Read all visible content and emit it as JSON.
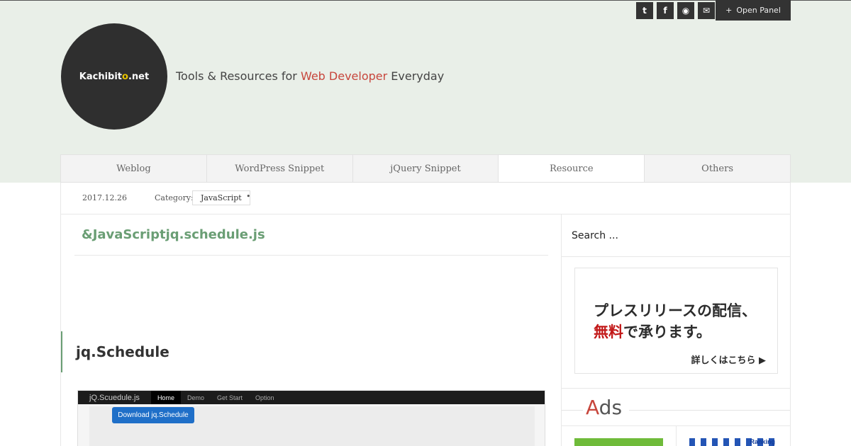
{
  "header": {
    "social": [
      {
        "icon": "twitter-icon",
        "glyph": "t"
      },
      {
        "icon": "facebook-icon",
        "glyph": "f"
      },
      {
        "icon": "rss-icon",
        "glyph": "◉"
      },
      {
        "icon": "mail-icon",
        "glyph": "✉"
      }
    ],
    "open_panel": {
      "plus": "+",
      "label": "Open Panel"
    },
    "logo": {
      "part1": "Kachibit",
      "highlight": "o",
      "part2": ".net"
    },
    "tagline": {
      "before": "Tools & Resources for ",
      "accent": "Web Developer",
      "after": " Everyday"
    }
  },
  "nav": {
    "tabs": [
      {
        "label": "Weblog"
      },
      {
        "label": "WordPress Snippet"
      },
      {
        "label": "jQuery Snippet"
      },
      {
        "label": "Resource"
      },
      {
        "label": "Others"
      }
    ]
  },
  "meta": {
    "date": "2017.12.26",
    "category_label": "Category:",
    "category": "JavaScript",
    "dot": "•"
  },
  "post": {
    "title": "&JavaScriptjq.schedule.js",
    "section_heading": "jq.Schedule",
    "screenshot": {
      "brand": "jQ.Scuedule.js",
      "menu": [
        "Home",
        "Demo",
        "Get Start",
        "Option"
      ],
      "button": "Download jq.Schedule"
    }
  },
  "sidebar": {
    "search_placeholder": "Search ...",
    "banner": {
      "line1": "プレスリリースの配信、",
      "line2_red": "無料",
      "line2_rest": "で承ります。",
      "more": "詳しくはこちら ▶"
    },
    "ads_heading": {
      "first": "A",
      "rest": "ds"
    },
    "ad_rank_label": "Ranking"
  },
  "colors": {
    "header_bg": "#e9efe8",
    "accent_red": "#c7463c",
    "title_green": "#6a9e74",
    "dark": "#333333"
  }
}
